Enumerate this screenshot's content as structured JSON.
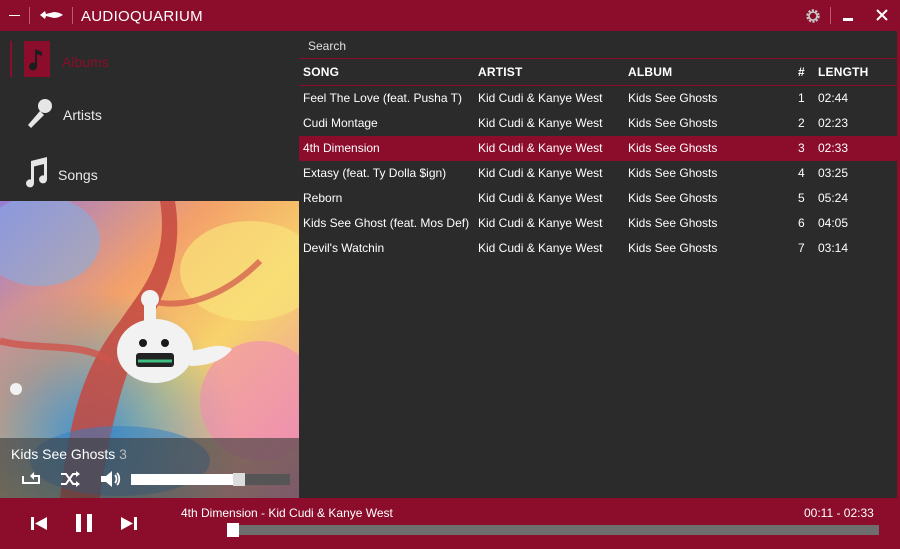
{
  "app": {
    "title": "AUDIOQUARIUM"
  },
  "sidebar": {
    "items": [
      {
        "label": "Albums",
        "icon": "music-note-icon",
        "active": true
      },
      {
        "label": "Artists",
        "icon": "microphone-icon",
        "active": false
      },
      {
        "label": "Songs",
        "icon": "music-notes-icon",
        "active": false
      }
    ]
  },
  "album": {
    "name": "Kids See Ghosts",
    "count": "3",
    "volume": 0.72
  },
  "search": {
    "label": "Search"
  },
  "table": {
    "headers": {
      "song": "SONG",
      "artist": "ARTIST",
      "album": "ALBUM",
      "num": "#",
      "length": "LENGTH"
    },
    "rows": [
      {
        "song": "Feel The Love (feat. Pusha T)",
        "artist": "Kid Cudi & Kanye West",
        "album": "Kids See Ghosts",
        "num": "1",
        "length": "02:44"
      },
      {
        "song": "Cudi Montage",
        "artist": "Kid Cudi & Kanye West",
        "album": "Kids See Ghosts",
        "num": "2",
        "length": "02:23"
      },
      {
        "song": "4th Dimension",
        "artist": "Kid Cudi & Kanye West",
        "album": "Kids See Ghosts",
        "num": "3",
        "length": "02:33"
      },
      {
        "song": "Extasy (feat. Ty Dolla $ign)",
        "artist": "Kid Cudi & Kanye West",
        "album": "Kids See Ghosts",
        "num": "4",
        "length": "03:25"
      },
      {
        "song": "Reborn",
        "artist": "Kid Cudi & Kanye West",
        "album": "Kids See Ghosts",
        "num": "5",
        "length": "05:24"
      },
      {
        "song": "Kids See Ghost (feat. Mos Def)",
        "artist": "Kid Cudi & Kanye West",
        "album": "Kids See Ghosts",
        "num": "6",
        "length": "04:05"
      },
      {
        "song": "Devil's Watchin",
        "artist": "Kid Cudi & Kanye West",
        "album": "Kids See Ghosts",
        "num": "7",
        "length": "03:14"
      }
    ],
    "active_row": 2
  },
  "player": {
    "now_playing": "4th Dimension - Kid Cudi & Kanye West",
    "time": "00:11  - 02:33",
    "progress": 0.072
  },
  "colors": {
    "accent": "#8b0d2b",
    "panel": "#2b2b2b"
  }
}
